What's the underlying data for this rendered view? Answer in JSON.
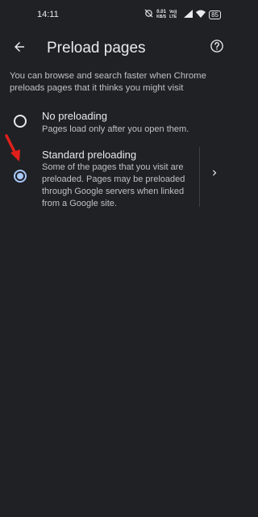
{
  "status_bar": {
    "time": "14:11",
    "net_speed_value": "0.01",
    "net_speed_unit": "KB/S",
    "network_type": "Vo)) LTE",
    "battery": "85"
  },
  "app_bar": {
    "title": "Preload pages",
    "back_icon": "arrow-back-icon",
    "help_icon": "help-circle-icon"
  },
  "description": "You can browse and search faster when Chrome preloads pages that it thinks you might visit",
  "options": [
    {
      "title": "No preloading",
      "subtitle": "Pages load only after you open them.",
      "selected": false
    },
    {
      "title": "Standard preloading",
      "subtitle": "Some of the pages that you visit are preloaded. Pages may be preloaded through Google servers when linked from a Google site.",
      "selected": true
    }
  ],
  "colors": {
    "background": "#202124",
    "text_primary": "#e8eaed",
    "text_secondary": "#bdc1c6",
    "accent": "#a8c7fa",
    "annotation_arrow": "#e0201b"
  }
}
